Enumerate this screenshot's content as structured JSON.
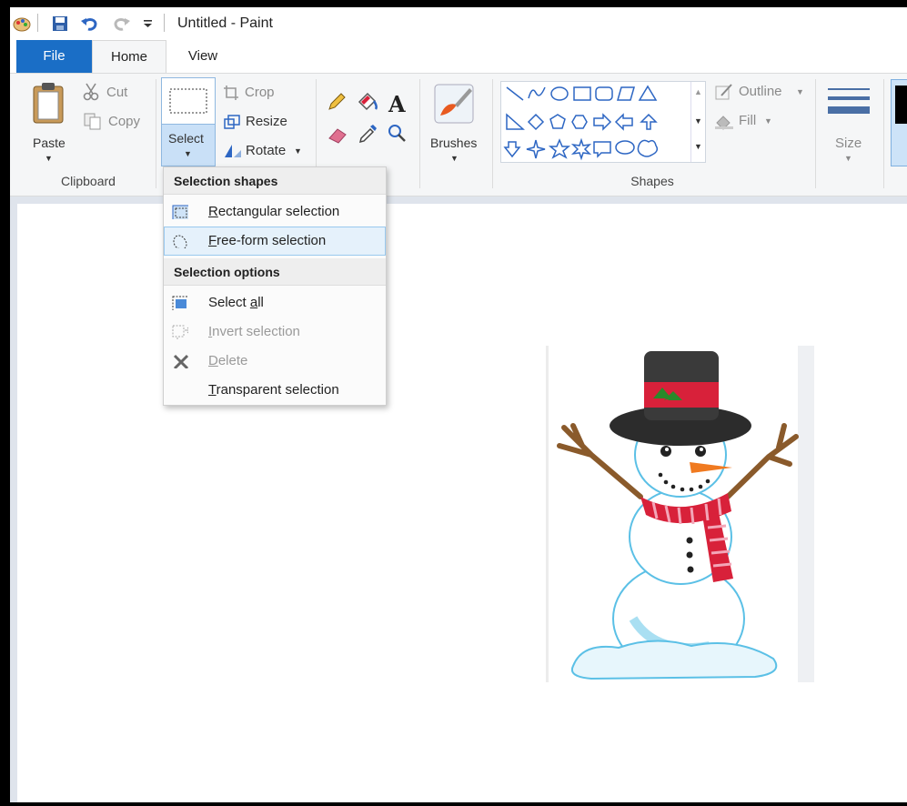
{
  "window": {
    "title": "Untitled - Paint"
  },
  "tabs": [
    {
      "label": "File"
    },
    {
      "label": "Home"
    },
    {
      "label": "View"
    }
  ],
  "ribbon": {
    "clipboard": {
      "paste": "Paste",
      "cut": "Cut",
      "copy": "Copy",
      "group": "Clipboard"
    },
    "image": {
      "select": "Select",
      "crop": "Crop",
      "resize": "Resize",
      "rotate": "Rotate"
    },
    "tools": {},
    "brushes": {
      "label": "Brushes"
    },
    "shapes": {
      "outline": "Outline",
      "fill": "Fill",
      "group": "Shapes"
    },
    "size": {
      "label": "Size"
    }
  },
  "dropdown": {
    "selection_shapes_header": "Selection shapes",
    "rect_pre": "",
    "rect_u": "R",
    "rect_post": "ectangular selection",
    "free_pre": "",
    "free_u": "F",
    "free_post": "ree-form selection",
    "selection_options_header": "Selection options",
    "all_pre": "Select ",
    "all_u": "a",
    "all_post": "ll",
    "inv_pre": "",
    "inv_u": "I",
    "inv_post": "nvert selection",
    "del_pre": "",
    "del_u": "D",
    "del_post": "elete",
    "trans_pre": "",
    "trans_u": "T",
    "trans_post": "ransparent selection"
  },
  "colors": {
    "file_tab": "#1a6ec6",
    "ribbon_bg": "#f5f6f7",
    "hover": "#e5f1fb",
    "scarf": "#d8213a",
    "hat": "#2c2c2c"
  }
}
